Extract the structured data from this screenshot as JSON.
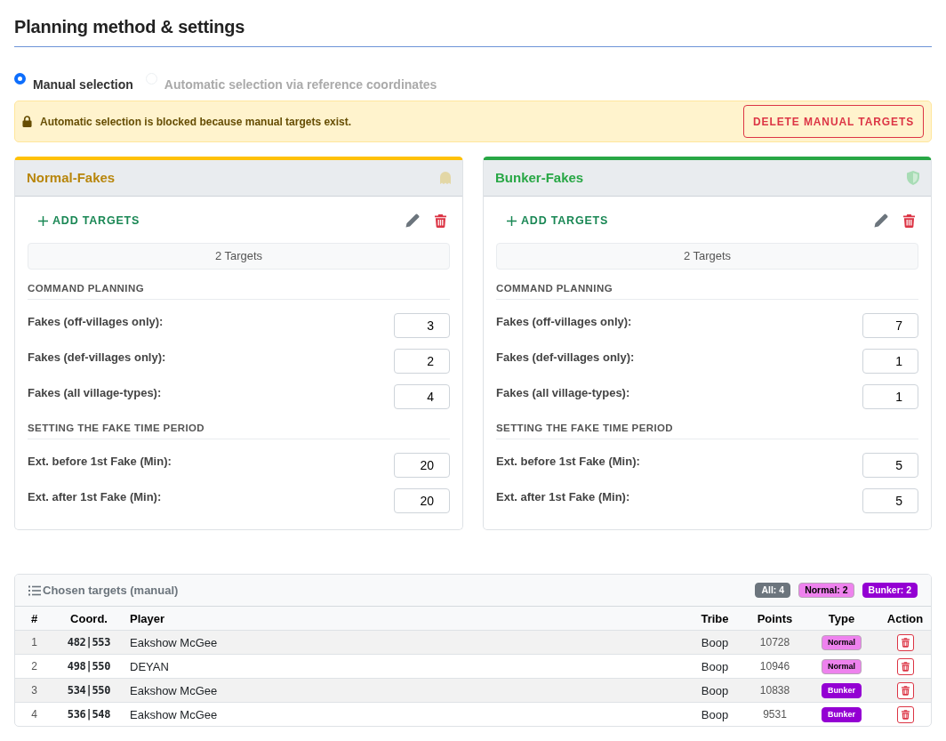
{
  "heading": "Planning method & settings",
  "method_options": [
    {
      "label": "Manual selection",
      "selected": true,
      "disabled": false
    },
    {
      "label": "Automatic selection via reference coordinates",
      "selected": false,
      "disabled": true
    }
  ],
  "alert": {
    "text": "Automatic selection is blocked because manual targets exist.",
    "button": "DELETE MANUAL TARGETS"
  },
  "groups": [
    {
      "title": "Normal-Fakes",
      "kind": "normal",
      "add_button": "ADD TARGETS",
      "target_count": "2 Targets",
      "sections": [
        {
          "title": "COMMAND PLANNING",
          "fields": [
            {
              "label": "Fakes (off-villages only):",
              "value": "3"
            },
            {
              "label": "Fakes (def-villages only):",
              "value": "2"
            },
            {
              "label": "Fakes (all village-types):",
              "value": "4"
            }
          ]
        },
        {
          "title": "SETTING THE FAKE TIME PERIOD",
          "fields": [
            {
              "label": "Ext. before 1st Fake (Min):",
              "value": "20"
            },
            {
              "label": "Ext. after 1st Fake (Min):",
              "value": "20"
            }
          ]
        }
      ]
    },
    {
      "title": "Bunker-Fakes",
      "kind": "bunker",
      "add_button": "ADD TARGETS",
      "target_count": "2 Targets",
      "sections": [
        {
          "title": "COMMAND PLANNING",
          "fields": [
            {
              "label": "Fakes (off-villages only):",
              "value": "7"
            },
            {
              "label": "Fakes (def-villages only):",
              "value": "1"
            },
            {
              "label": "Fakes (all village-types):",
              "value": "1"
            }
          ]
        },
        {
          "title": "SETTING THE FAKE TIME PERIOD",
          "fields": [
            {
              "label": "Ext. before 1st Fake (Min):",
              "value": "5"
            },
            {
              "label": "Ext. after 1st Fake (Min):",
              "value": "5"
            }
          ]
        }
      ]
    }
  ],
  "targets": {
    "title": "Chosen targets (manual)",
    "badges": [
      {
        "label": "All: 4",
        "kind": "all"
      },
      {
        "label": "Normal: 2",
        "kind": "normal"
      },
      {
        "label": "Bunker: 2",
        "kind": "bunker"
      }
    ],
    "columns": [
      "#",
      "Coord.",
      "Player",
      "Tribe",
      "Points",
      "Type",
      "Action"
    ],
    "rows": [
      {
        "index": "1",
        "coord": "482|553",
        "player": "Eakshow McGee",
        "tribe": "Boop",
        "points": "10728",
        "type": "Normal",
        "kind": "normal"
      },
      {
        "index": "2",
        "coord": "498|550",
        "player": "DEYAN",
        "tribe": "Boop",
        "points": "10946",
        "type": "Normal",
        "kind": "normal"
      },
      {
        "index": "3",
        "coord": "534|550",
        "player": "Eakshow McGee",
        "tribe": "Boop",
        "points": "10838",
        "type": "Bunker",
        "kind": "bunker"
      },
      {
        "index": "4",
        "coord": "536|548",
        "player": "Eakshow McGee",
        "tribe": "Boop",
        "points": "9531",
        "type": "Bunker",
        "kind": "bunker"
      }
    ]
  }
}
